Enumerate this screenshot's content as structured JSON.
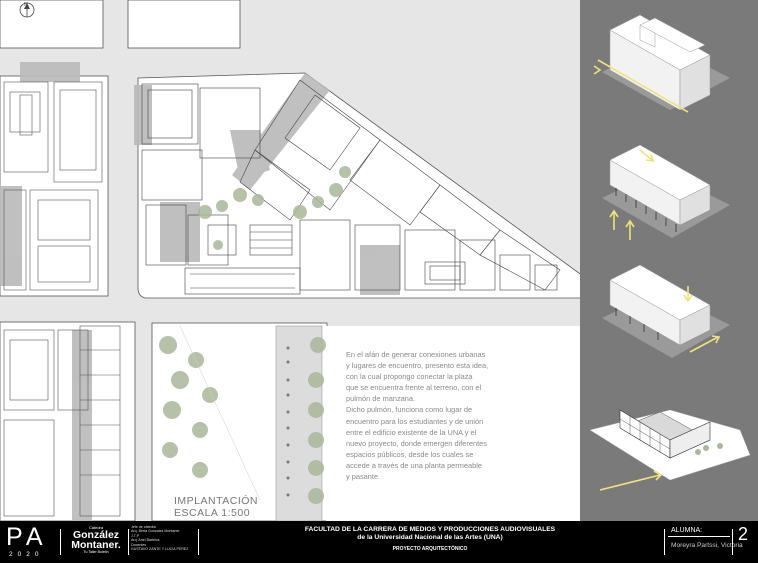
{
  "plan": {
    "north_label": "N",
    "scale_title": "IMPLANTACIÓN",
    "scale_value": "ESCALA 1:500"
  },
  "description": [
    "En el afán de generar conexiones urbanas",
    "y lugares de encuentro, presento esta idea,",
    "con la cual propongo conectar la plaza",
    "que se encuentra frente al terreno, con el",
    "pulmón de manzana.",
    "Dicho pulmón, funciona como lugar de",
    "encuentro para los estudiantes y de unión",
    "entre el edificio existente de la UNA y el",
    "nuevo proyecto, donde emergen diferentes",
    "espacios públicos, desde los cuales se",
    "accede a través de una planta permeable",
    "y pasante."
  ],
  "footer": {
    "brand": "PA",
    "year": "2020",
    "catedra_label": "Cátedra",
    "catedra_name_1": "González",
    "catedra_name_2": "Montaner.",
    "catedra_sub": "Tu Taller Boletín",
    "staff": [
      "Jefe de cátedra",
      "Arq. Berta Gonzalez Montaner",
      "J.T.P.",
      "Arq. Ariel Barbilos",
      "Docentes",
      "GUSTAVO ZANTE Y LUCIA PEREZ"
    ],
    "faculty_line_1": "FACULTAD DE LA CARRERA DE MEDIOS Y PRODUCCIONES AUDIOVISUALES",
    "faculty_line_2": "de la Universidad Nacional de las Artes (UNA)",
    "project": "PROYECTO ARQUITECTÓNICO",
    "student_label": "ALUMNA:",
    "student_name": "Moreyra Partssi, Victoria",
    "sheet_number": "2"
  },
  "colors": {
    "plan_bg": "#e6e6e6",
    "side_bg": "#7a7a7a",
    "accent_arrow": "#f2e27a",
    "vegetation": "#a9b89a",
    "footer_bg": "#000000"
  }
}
